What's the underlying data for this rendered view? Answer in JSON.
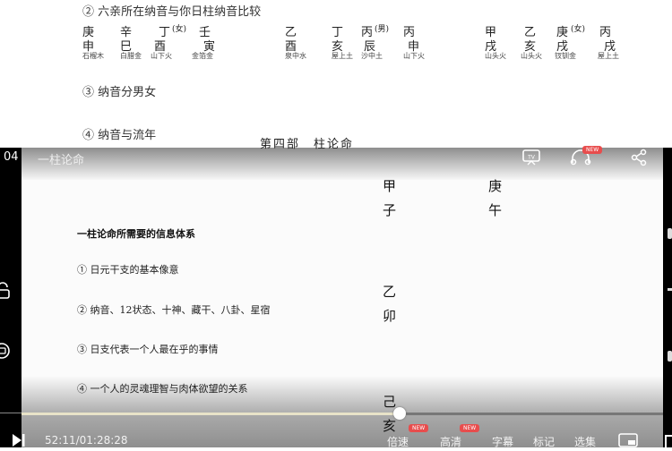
{
  "document": {
    "heading": "② 六亲所在纳音与你日柱纳音比较",
    "groups": [
      {
        "stems": [
          "庚",
          "辛",
          "丁",
          "壬"
        ],
        "gender": "(女)",
        "branches": [
          "申",
          "巳",
          "酉",
          "寅"
        ],
        "nayin": [
          "石榴木",
          "白腊金",
          "山下火",
          "金箔金"
        ]
      },
      {
        "stems": [
          "乙",
          "丁",
          "丙",
          "丙"
        ],
        "gender": "(男)",
        "branches": [
          "酉",
          "亥",
          "辰",
          "申"
        ],
        "nayin": [
          "泉中水",
          "屋上土",
          "沙中土",
          "山下火"
        ]
      },
      {
        "stems": [
          "甲",
          "乙",
          "庚",
          "丙"
        ],
        "gender": "(女)",
        "branches": [
          "戌",
          "亥",
          "戌",
          "戌"
        ],
        "nayin": [
          "山头火",
          "山头火",
          "钗钏金",
          "屋上土"
        ]
      }
    ],
    "section3": "③ 纳音分男女",
    "section4": "④ 纳音与流年"
  },
  "player": {
    "episode_number": "04",
    "episode_title": "一柱论命",
    "slide_title_partial": "第四部　柱论命",
    "slide": {
      "heading": "一柱论命所需要的信息体系",
      "items": [
        "① 日元干支的基本像意",
        "② 纳音、12状态、十神、藏干、八卦、星宿",
        "③ 日支代表一个人最在乎的事情",
        "④ 一个人的灵魂理智与肉体欲望的关系"
      ],
      "pillars": [
        {
          "stem": "甲",
          "branch": "子"
        },
        {
          "stem": "庚",
          "branch": "午"
        },
        {
          "stem": "乙",
          "branch": "卯"
        },
        {
          "stem": "己",
          "branch": "亥"
        }
      ]
    },
    "icons": {
      "cast": "tv-cast-icon",
      "listen": "headphones-icon",
      "share": "share-icon",
      "lock": "lock-icon",
      "screenshot": "screenshot-icon",
      "play": "play-next-icon",
      "pip": "picture-in-picture-icon"
    },
    "new_badge": "NEW",
    "current_time": "52:11",
    "total_time": "01:28:28",
    "time_display": "52:11/01:28:28",
    "progress": 0.59,
    "controls": {
      "speed": "倍速",
      "quality": "高清",
      "subtitle": "字幕",
      "bookmark": "标记",
      "episodes": "选集"
    },
    "colors": {
      "new_badge": "#e84d4d",
      "progress_played": "#e8e3c8",
      "progress_track": "#777777"
    }
  }
}
